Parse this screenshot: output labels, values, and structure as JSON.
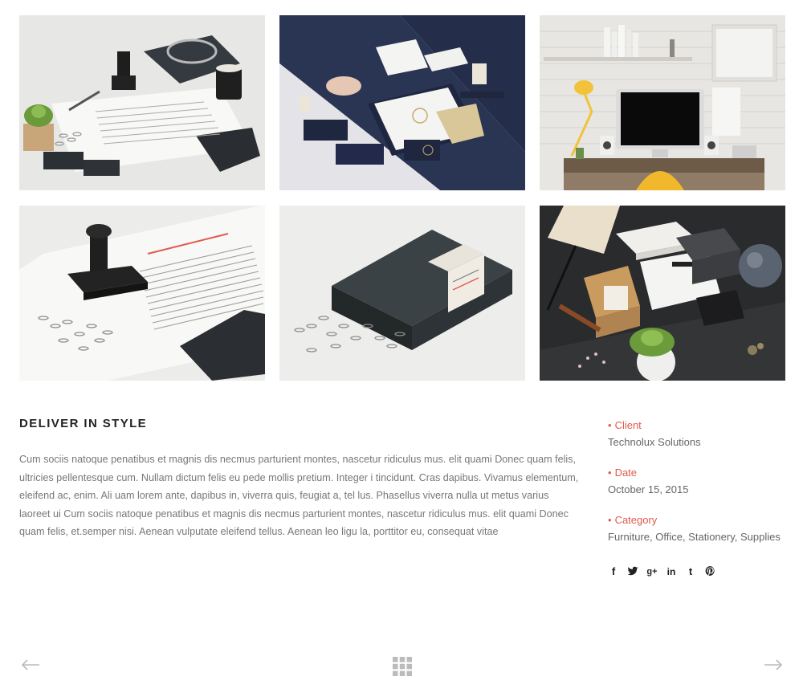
{
  "gallery": {
    "items": [
      {
        "name": "letterhead-stamp-candle"
      },
      {
        "name": "navy-stationery-set"
      },
      {
        "name": "desk-workspace"
      },
      {
        "name": "letterhead-stamp-closeup"
      },
      {
        "name": "dark-box-paperclips"
      },
      {
        "name": "north-branding-set"
      }
    ]
  },
  "project": {
    "title": "DELIVER IN STYLE",
    "description": "Cum sociis natoque penatibus et magnis dis necmus parturient montes, nascetur ridiculus mus. elit quami Donec quam felis, ultricies pellentesque cum. Nullam dictum felis eu pede mollis pretium. Integer i tincidunt. Cras dapibus. Vivamus elementum, eleifend ac, enim. Ali uam lorem ante, dapibus in, viverra quis, feugiat a, tel lus. Phasellus viverra nulla ut metus varius laoreet ui Cum sociis natoque penatibus et magnis dis necmus parturient montes, nascetur ridiculus mus. elit quami Donec quam felis, et.semper nisi. Aenean vulputate eleifend tellus. Aenean leo ligu la, porttitor eu, consequat vitae"
  },
  "meta": {
    "bullet": "•",
    "client": {
      "label": "Client",
      "value": "Technolux Solutions"
    },
    "date": {
      "label": "Date",
      "value": "October 15, 2015"
    },
    "category": {
      "label": "Category",
      "value": "Furniture, Office, Stationery, Supplies"
    }
  },
  "social": {
    "facebook": "f",
    "twitter": "t",
    "googleplus": "g+",
    "linkedin": "in",
    "tumblr": "t",
    "pinterest": "p"
  },
  "nav": {
    "prev_icon": "arrow-left-icon",
    "grid_icon": "grid-icon",
    "next_icon": "arrow-right-icon"
  },
  "colors": {
    "accent": "#e05a4e",
    "heading": "#222222",
    "body_text": "#777777",
    "nav_icon": "#bbbbbb"
  }
}
